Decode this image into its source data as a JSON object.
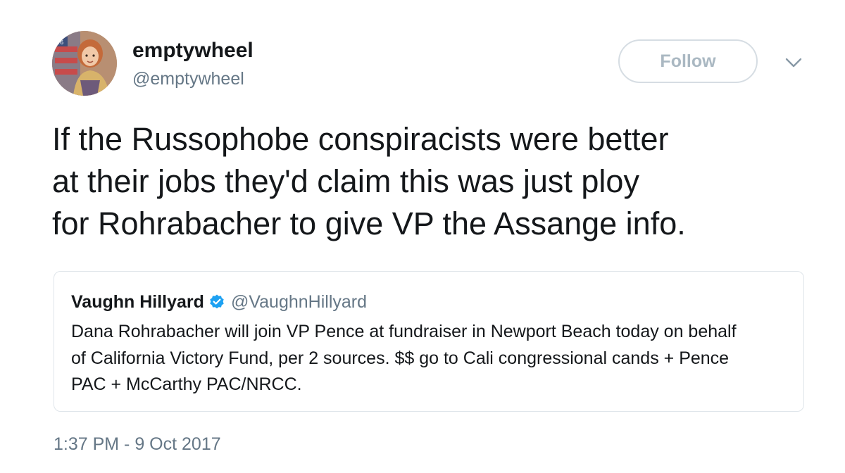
{
  "author": {
    "display_name": "emptywheel",
    "handle": "@emptywheel",
    "avatar_icon": "profile-photo"
  },
  "follow_button": {
    "label": "Follow"
  },
  "menu_icon": "chevron-down-icon",
  "tweet": {
    "text": "If the Russophobe conspiracists were better\nat their jobs they'd claim this was just ploy\nfor Rohrabacher to give VP the Assange info."
  },
  "quoted_tweet": {
    "display_name": "Vaughn Hillyard",
    "verified_icon": "verified-badge-icon",
    "handle": "@VaughnHillyard",
    "text": "Dana Rohrabacher will join VP Pence at fundraiser in Newport Beach today on behalf\nof California Victory Fund, per 2 sources. $$ go to Cali congressional cands + Pence\nPAC + McCarthy PAC/NRCC."
  },
  "timestamp": "1:37 PM - 9 Oct 2017",
  "colors": {
    "text_primary": "#14171a",
    "text_secondary": "#657786",
    "verified_blue": "#1da1f2",
    "follow_border": "#d6dde3",
    "follow_text": "#aab8c2",
    "card_border": "#dfe5ea"
  }
}
